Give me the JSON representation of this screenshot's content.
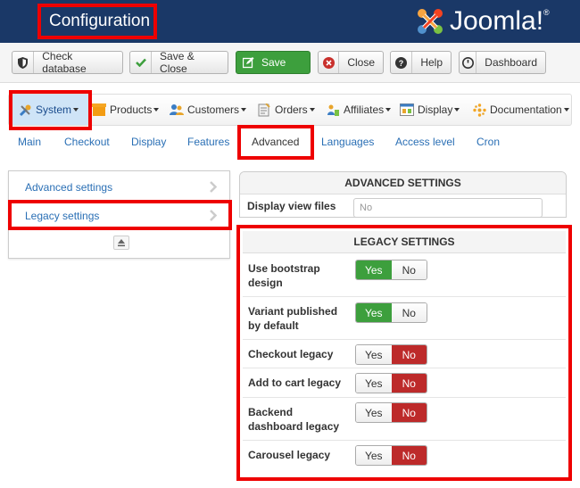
{
  "header": {
    "title": "Configuration",
    "logo_text": "Joomla!"
  },
  "toolbar": {
    "check_database": "Check database",
    "save_close": "Save & Close",
    "save": "Save",
    "close": "Close",
    "help": "Help",
    "dashboard": "Dashboard"
  },
  "menu": {
    "system": "System",
    "products": "Products",
    "customers": "Customers",
    "orders": "Orders",
    "affiliates": "Affiliates",
    "display": "Display",
    "documentation": "Documentation"
  },
  "tabs": [
    "Main",
    "Checkout",
    "Display",
    "Features",
    "Advanced",
    "Languages",
    "Access level",
    "Cron"
  ],
  "sidebar": {
    "items": [
      "Advanced settings",
      "Legacy settings"
    ]
  },
  "advanced": {
    "header": "ADVANCED SETTINGS",
    "first_row_label": "Display view files",
    "first_row_value": "No"
  },
  "legacy": {
    "header": "LEGACY SETTINGS",
    "yes_label": "Yes",
    "no_label": "No",
    "rows": [
      {
        "label": "Use bootstrap design",
        "value": "Yes"
      },
      {
        "label": "Variant published by default",
        "value": "Yes"
      },
      {
        "label": "Checkout legacy",
        "value": "No"
      },
      {
        "label": "Add to cart legacy",
        "value": "No"
      },
      {
        "label": "Backend dashboard legacy",
        "value": "No"
      },
      {
        "label": "Carousel legacy",
        "value": "No"
      }
    ]
  },
  "colors": {
    "header_bg": "#1a3867",
    "highlight": "#ee0000",
    "yes_active": "#3d9f3d",
    "no_active": "#bd2a2a",
    "link": "#2a6fb5"
  }
}
